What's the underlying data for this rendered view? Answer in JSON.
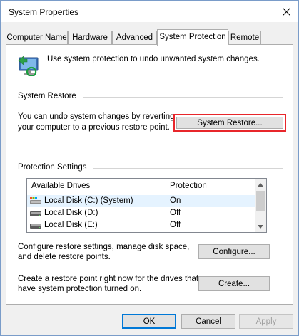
{
  "window": {
    "title": "System Properties"
  },
  "tabs": [
    {
      "label": "Computer Name",
      "active": false
    },
    {
      "label": "Hardware",
      "active": false
    },
    {
      "label": "Advanced",
      "active": false
    },
    {
      "label": "System Protection",
      "active": true
    },
    {
      "label": "Remote",
      "active": false
    }
  ],
  "intro": {
    "text": "Use system protection to undo unwanted system changes."
  },
  "system_restore": {
    "heading": "System Restore",
    "description_line1": "You can undo system changes by reverting",
    "description_line2": "your computer to a previous restore point.",
    "button_label": "System Restore...",
    "highlight_color": "#e8262b"
  },
  "protection_settings": {
    "heading": "Protection Settings",
    "columns": [
      "Available Drives",
      "Protection"
    ],
    "drives": [
      {
        "name": "Local Disk (C:) (System)",
        "protection": "On",
        "icon": "system-drive-icon",
        "selected": true
      },
      {
        "name": "Local Disk (D:)",
        "protection": "Off",
        "icon": "drive-icon",
        "selected": false
      },
      {
        "name": "Local Disk (E:)",
        "protection": "Off",
        "icon": "drive-icon",
        "selected": false
      }
    ]
  },
  "configure": {
    "line1": "Configure restore settings, manage disk space,",
    "line2": "and delete restore points.",
    "button_label": "Configure..."
  },
  "create": {
    "line1": "Create a restore point right now for the drives that",
    "line2": "have system protection turned on.",
    "button_label": "Create..."
  },
  "footer": {
    "ok": "OK",
    "cancel": "Cancel",
    "apply": "Apply"
  }
}
